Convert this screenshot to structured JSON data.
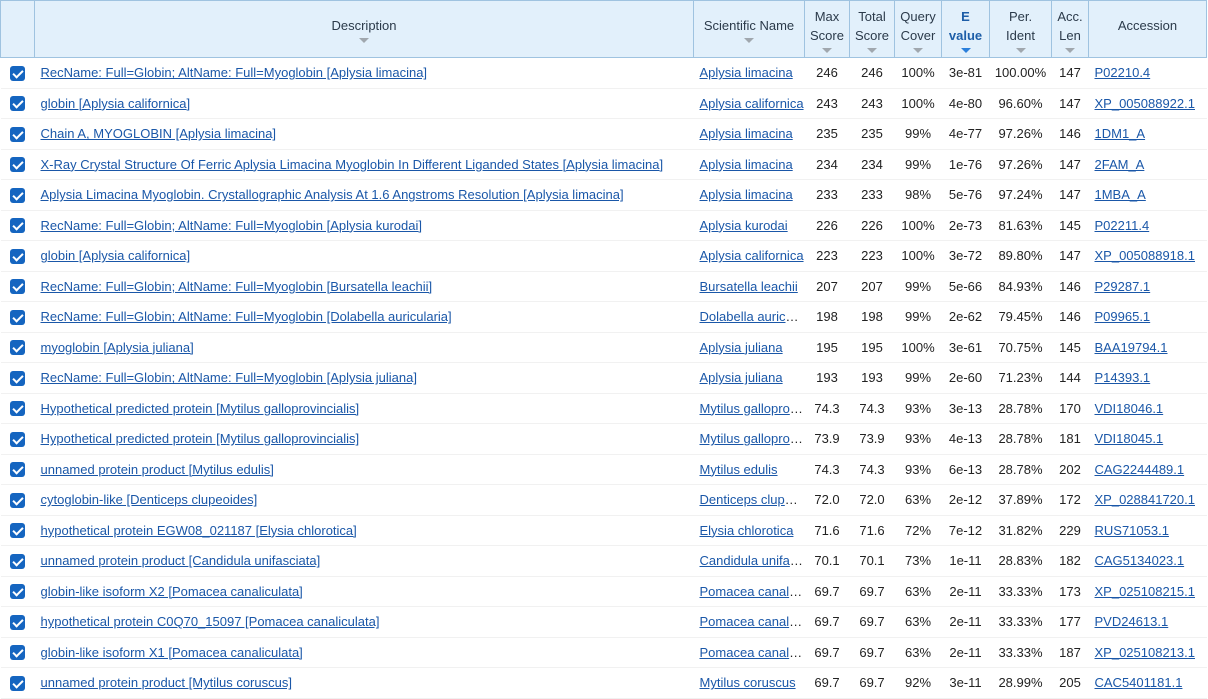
{
  "headers": {
    "description": "Description",
    "scientific_name": "Scientific Name",
    "max_score": [
      "Max",
      "Score"
    ],
    "total_score": [
      "Total",
      "Score"
    ],
    "query_cover": [
      "Query",
      "Cover"
    ],
    "e_value": [
      "E",
      "value"
    ],
    "per_ident": [
      "Per.",
      "Ident"
    ],
    "acc_len": [
      "Acc.",
      "Len"
    ],
    "accession": "Accession"
  },
  "sorted_column": "e_value",
  "rows": [
    {
      "desc": "RecName: Full=Globin; AltName: Full=Myoglobin [Aplysia limacina]",
      "sci": "Aplysia limacina",
      "max": "246",
      "total": "246",
      "cover": "100%",
      "e": "3e-81",
      "ident": "100.00%",
      "len": "147",
      "acc": "P02210.4"
    },
    {
      "desc": "globin [Aplysia californica]",
      "sci": "Aplysia californica",
      "max": "243",
      "total": "243",
      "cover": "100%",
      "e": "4e-80",
      "ident": "96.60%",
      "len": "147",
      "acc": "XP_005088922.1"
    },
    {
      "desc": "Chain A, MYOGLOBIN [Aplysia limacina]",
      "sci": "Aplysia limacina",
      "max": "235",
      "total": "235",
      "cover": "99%",
      "e": "4e-77",
      "ident": "97.26%",
      "len": "146",
      "acc": "1DM1_A"
    },
    {
      "desc": "X-Ray Crystal Structure Of Ferric Aplysia Limacina Myoglobin In Different Liganded States [Aplysia limacina]",
      "sci": "Aplysia limacina",
      "max": "234",
      "total": "234",
      "cover": "99%",
      "e": "1e-76",
      "ident": "97.26%",
      "len": "147",
      "acc": "2FAM_A"
    },
    {
      "desc": "Aplysia Limacina Myoglobin. Crystallographic Analysis At 1.6 Angstroms Resolution [Aplysia limacina]",
      "sci": "Aplysia limacina",
      "max": "233",
      "total": "233",
      "cover": "98%",
      "e": "5e-76",
      "ident": "97.24%",
      "len": "147",
      "acc": "1MBA_A"
    },
    {
      "desc": "RecName: Full=Globin; AltName: Full=Myoglobin [Aplysia kurodai]",
      "sci": "Aplysia kurodai",
      "max": "226",
      "total": "226",
      "cover": "100%",
      "e": "2e-73",
      "ident": "81.63%",
      "len": "145",
      "acc": "P02211.4"
    },
    {
      "desc": "globin [Aplysia californica]",
      "sci": "Aplysia californica",
      "max": "223",
      "total": "223",
      "cover": "100%",
      "e": "3e-72",
      "ident": "89.80%",
      "len": "147",
      "acc": "XP_005088918.1"
    },
    {
      "desc": "RecName: Full=Globin; AltName: Full=Myoglobin [Bursatella leachii]",
      "sci": "Bursatella leachii",
      "max": "207",
      "total": "207",
      "cover": "99%",
      "e": "5e-66",
      "ident": "84.93%",
      "len": "146",
      "acc": "P29287.1"
    },
    {
      "desc": "RecName: Full=Globin; AltName: Full=Myoglobin [Dolabella auricularia]",
      "sci": "Dolabella auricularia",
      "max": "198",
      "total": "198",
      "cover": "99%",
      "e": "2e-62",
      "ident": "79.45%",
      "len": "146",
      "acc": "P09965.1"
    },
    {
      "desc": "myoglobin [Aplysia juliana]",
      "sci": "Aplysia juliana",
      "max": "195",
      "total": "195",
      "cover": "100%",
      "e": "3e-61",
      "ident": "70.75%",
      "len": "145",
      "acc": "BAA19794.1"
    },
    {
      "desc": "RecName: Full=Globin; AltName: Full=Myoglobin [Aplysia juliana]",
      "sci": "Aplysia juliana",
      "max": "193",
      "total": "193",
      "cover": "99%",
      "e": "2e-60",
      "ident": "71.23%",
      "len": "144",
      "acc": "P14393.1"
    },
    {
      "desc": "Hypothetical predicted protein [Mytilus galloprovincialis]",
      "sci": "Mytilus galloprovincialis",
      "max": "74.3",
      "total": "74.3",
      "cover": "93%",
      "e": "3e-13",
      "ident": "28.78%",
      "len": "170",
      "acc": "VDI18046.1"
    },
    {
      "desc": "Hypothetical predicted protein [Mytilus galloprovincialis]",
      "sci": "Mytilus galloprovincialis",
      "max": "73.9",
      "total": "73.9",
      "cover": "93%",
      "e": "4e-13",
      "ident": "28.78%",
      "len": "181",
      "acc": "VDI18045.1"
    },
    {
      "desc": "unnamed protein product [Mytilus edulis]",
      "sci": "Mytilus edulis",
      "max": "74.3",
      "total": "74.3",
      "cover": "93%",
      "e": "6e-13",
      "ident": "28.78%",
      "len": "202",
      "acc": "CAG2244489.1"
    },
    {
      "desc": "cytoglobin-like [Denticeps clupeoides]",
      "sci": "Denticeps clupeoides",
      "max": "72.0",
      "total": "72.0",
      "cover": "63%",
      "e": "2e-12",
      "ident": "37.89%",
      "len": "172",
      "acc": "XP_028841720.1"
    },
    {
      "desc": "hypothetical protein EGW08_021187 [Elysia chlorotica]",
      "sci": "Elysia chlorotica",
      "max": "71.6",
      "total": "71.6",
      "cover": "72%",
      "e": "7e-12",
      "ident": "31.82%",
      "len": "229",
      "acc": "RUS71053.1"
    },
    {
      "desc": "unnamed protein product [Candidula unifasciata]",
      "sci": "Candidula unifasciata",
      "max": "70.1",
      "total": "70.1",
      "cover": "73%",
      "e": "1e-11",
      "ident": "28.83%",
      "len": "182",
      "acc": "CAG5134023.1"
    },
    {
      "desc": "globin-like isoform X2 [Pomacea canaliculata]",
      "sci": "Pomacea canaliculata",
      "max": "69.7",
      "total": "69.7",
      "cover": "63%",
      "e": "2e-11",
      "ident": "33.33%",
      "len": "173",
      "acc": "XP_025108215.1"
    },
    {
      "desc": "hypothetical protein C0Q70_15097 [Pomacea canaliculata]",
      "sci": "Pomacea canaliculata",
      "max": "69.7",
      "total": "69.7",
      "cover": "63%",
      "e": "2e-11",
      "ident": "33.33%",
      "len": "177",
      "acc": "PVD24613.1"
    },
    {
      "desc": "globin-like isoform X1 [Pomacea canaliculata]",
      "sci": "Pomacea canaliculata",
      "max": "69.7",
      "total": "69.7",
      "cover": "63%",
      "e": "2e-11",
      "ident": "33.33%",
      "len": "187",
      "acc": "XP_025108213.1"
    },
    {
      "desc": "unnamed protein product [Mytilus coruscus]",
      "sci": "Mytilus coruscus",
      "max": "69.7",
      "total": "69.7",
      "cover": "92%",
      "e": "3e-11",
      "ident": "28.99%",
      "len": "205",
      "acc": "CAC5401181.1"
    }
  ]
}
